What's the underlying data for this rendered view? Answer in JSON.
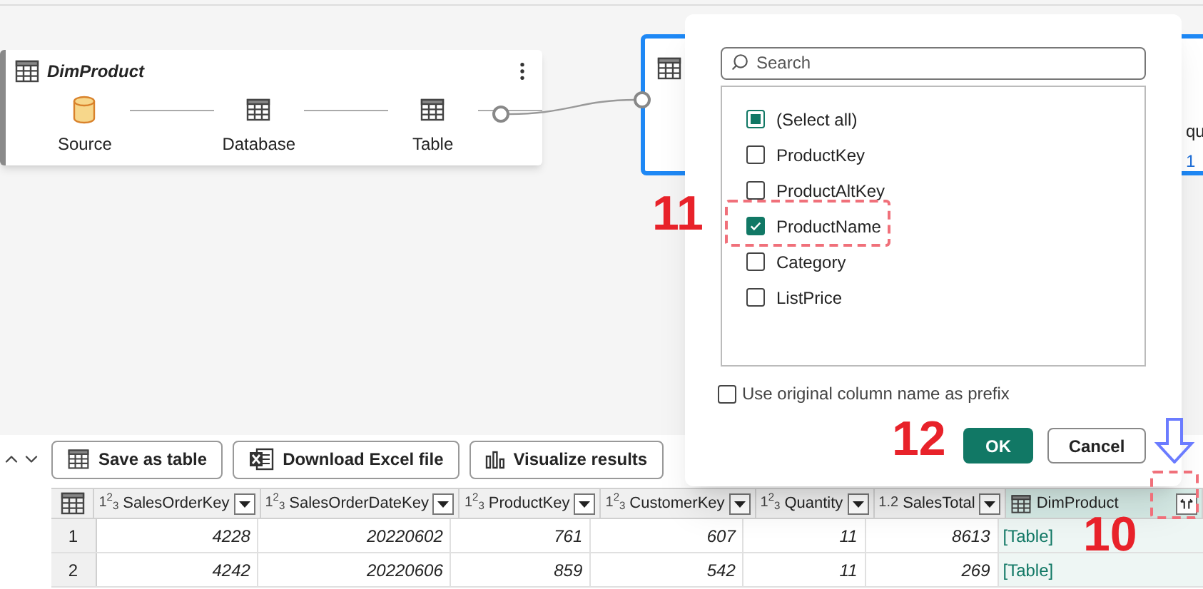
{
  "canvas": {
    "node": {
      "title": "DimProduct",
      "steps": [
        {
          "kind": "source",
          "label": "Source"
        },
        {
          "kind": "table",
          "label": "Database"
        },
        {
          "kind": "table",
          "label": "Table"
        }
      ]
    },
    "second_node": {
      "selected": true,
      "texts": [
        "qu",
        "1"
      ]
    }
  },
  "toolbar": {
    "buttons": [
      {
        "kind": "table",
        "label": "Save as table"
      },
      {
        "kind": "excel",
        "label": "Download Excel file"
      },
      {
        "kind": "chart",
        "label": "Visualize results"
      }
    ]
  },
  "table": {
    "columns": [
      {
        "kind": "number",
        "type_label": "1$^{2}$$_{3}$",
        "name": "SalesOrderKey"
      },
      {
        "kind": "number",
        "type_label": "1$^{2}$$_{3}$",
        "name": "SalesOrderDateKey"
      },
      {
        "kind": "number",
        "type_label": "1$^{2}$$_{3}$",
        "name": "ProductKey"
      },
      {
        "kind": "number",
        "type_label": "1$^{2}$$_{3}$",
        "name": "CustomerKey"
      },
      {
        "kind": "number",
        "type_label": "1$^{2}$$_{3}$",
        "name": "Quantity"
      },
      {
        "kind": "number",
        "type_label": "1.2",
        "name": "SalesTotal"
      },
      {
        "kind": "table",
        "name": "DimProduct"
      }
    ],
    "rows": [
      {
        "number": "1",
        "cells": [
          "4228",
          "20220602",
          "761",
          "607",
          "11",
          "8613",
          "[Table]"
        ]
      },
      {
        "number": "2",
        "cells": [
          "4242",
          "20220606",
          "859",
          "542",
          "11",
          "269",
          "[Table]"
        ]
      }
    ]
  },
  "dialog": {
    "search": {
      "placeholder": "Search"
    },
    "select_all": {
      "label": "(Select all)",
      "partial": true
    },
    "options": [
      {
        "label": "ProductKey",
        "checked": false
      },
      {
        "label": "ProductAltKey",
        "checked": false
      },
      {
        "label": "ProductName",
        "checked": true
      },
      {
        "label": "Category",
        "checked": false
      },
      {
        "label": "ListPrice",
        "checked": false
      }
    ],
    "prefix": {
      "label": "Use original column name as prefix",
      "checked": false
    },
    "buttons": [
      {
        "label": "OK",
        "primary": true
      },
      {
        "label": "Cancel",
        "primary": false
      }
    ]
  },
  "annotations": [
    {
      "kind": "number",
      "text": "11"
    },
    {
      "kind": "number",
      "text": "12"
    },
    {
      "kind": "number",
      "text": "10"
    },
    {
      "kind": "highlight"
    },
    {
      "kind": "highlight"
    },
    {
      "kind": "arrow"
    }
  ]
}
